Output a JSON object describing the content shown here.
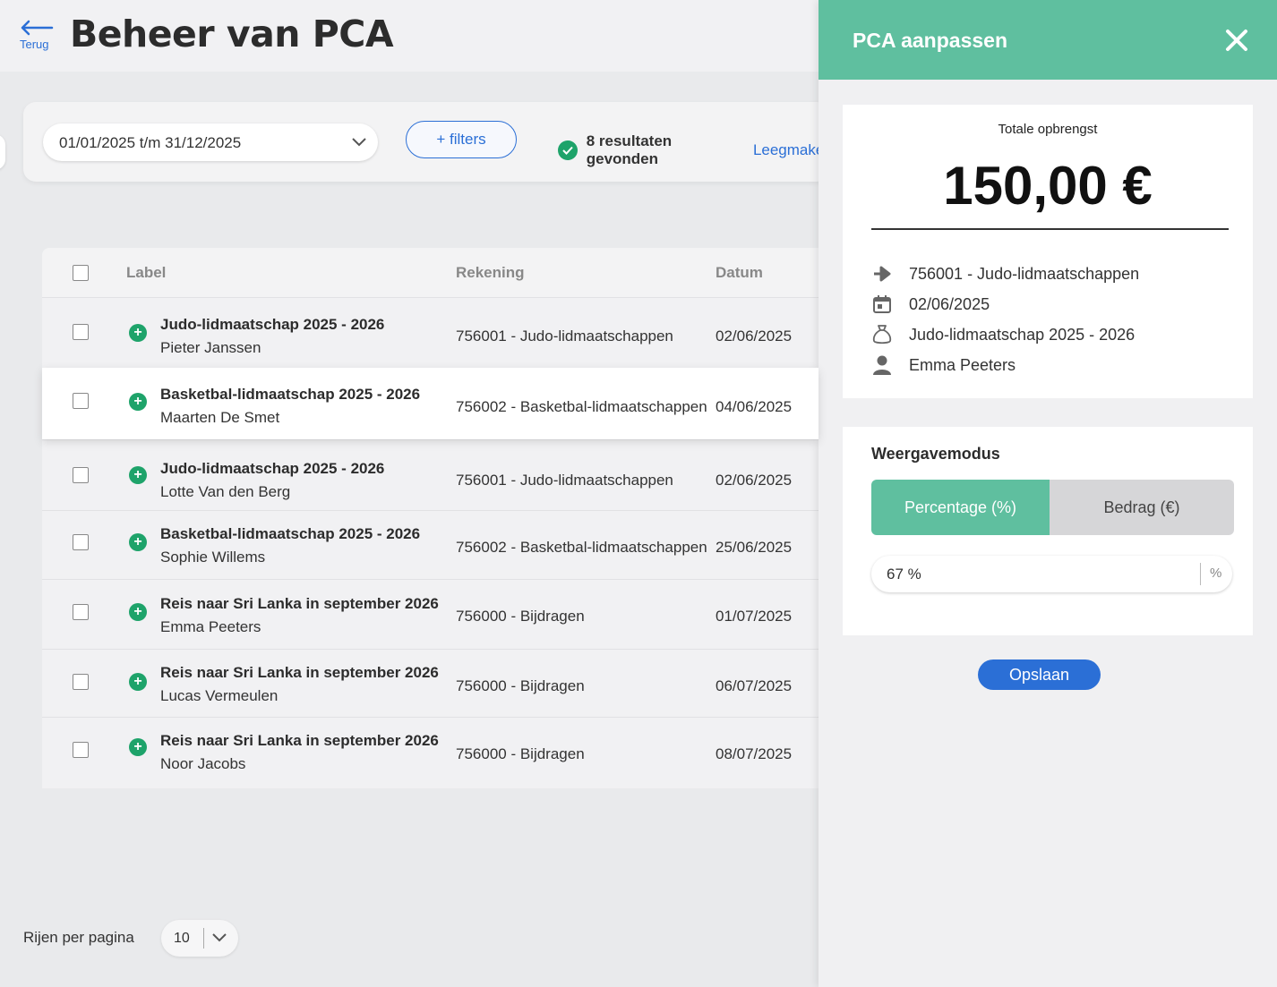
{
  "header": {
    "back_label": "Terug",
    "title": "Beheer van PCA"
  },
  "filters": {
    "date_range": "01/01/2025 t/m 31/12/2025",
    "filter_button": "+ filters",
    "results_text": "8 resultaten gevonden",
    "clear_link": "Leegmaker"
  },
  "table": {
    "columns": [
      "Label",
      "Rekening",
      "Datum"
    ],
    "rows": [
      {
        "title": "Judo-lidmaatschap 2025 - 2026",
        "name": "Pieter Janssen",
        "account": "756001 - Judo-lidmaatschappen",
        "date": "02/06/2025"
      },
      {
        "title": "Basketbal-lidmaatschap 2025 - 2026",
        "name": "Maarten De Smet",
        "account": "756002 - Basketbal-lidmaatschappen",
        "date": "04/06/2025"
      },
      {
        "title": "Judo-lidmaatschap 2025 - 2026",
        "name": "Lotte Van den Berg",
        "account": "756001 - Judo-lidmaatschappen",
        "date": "02/06/2025"
      },
      {
        "title": "Basketbal-lidmaatschap 2025 - 2026",
        "name": "Sophie Willems",
        "account": "756002 - Basketbal-lidmaatschappen",
        "date": "25/06/2025"
      },
      {
        "title": "Reis naar Sri Lanka in september 2026",
        "name": "Emma Peeters",
        "account": "756000 - Bijdragen",
        "date": "01/07/2025"
      },
      {
        "title": "Reis naar Sri Lanka in september 2026",
        "name": "Lucas Vermeulen",
        "account": "756000 - Bijdragen",
        "date": "06/07/2025"
      },
      {
        "title": "Reis naar Sri Lanka in september 2026",
        "name": "Noor Jacobs",
        "account": "756000 - Bijdragen",
        "date": "08/07/2025"
      }
    ],
    "selected_row": 1
  },
  "pagination": {
    "label": "Rijen per pagina",
    "value": "10"
  },
  "panel": {
    "title": "PCA aanpassen",
    "total_label": "Totale opbrengst",
    "total_value": "150,00 €",
    "details": {
      "account": "756001 - Judo-lidmaatschappen",
      "date": "02/06/2025",
      "label": "Judo-lidmaatschap 2025 - 2026",
      "person": "Emma Peeters"
    },
    "mode_label": "Weergavemodus",
    "mode_percentage": "Percentage (%)",
    "mode_amount": "Bedrag (€)",
    "percentage_value": "67 %",
    "percentage_unit": "%",
    "save_label": "Opslaan"
  },
  "colors": {
    "accent_green": "#5fbf9f",
    "primary_blue": "#2b6fd6",
    "status_green": "#1ea36a"
  }
}
